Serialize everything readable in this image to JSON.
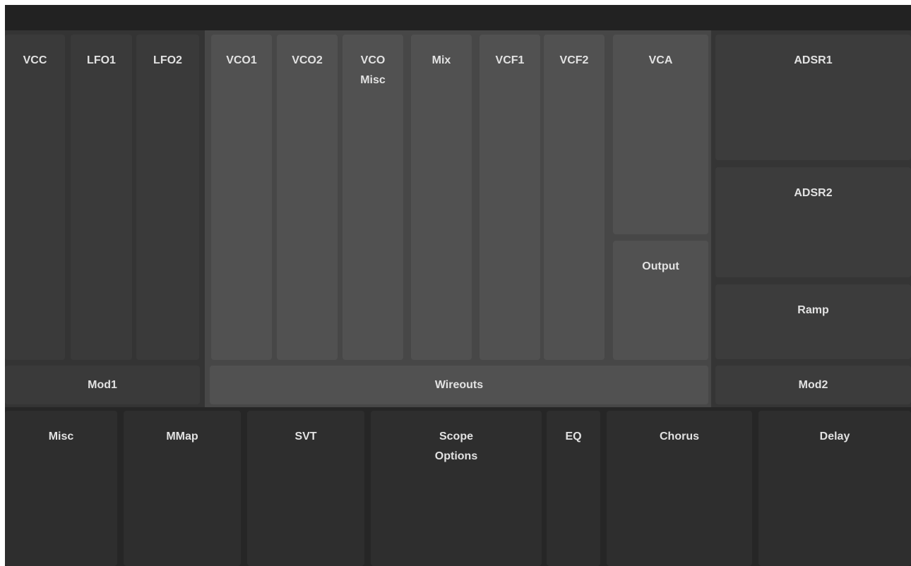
{
  "colors": {
    "window_background": "#222222",
    "left_zone": "#343434",
    "left_panel": "#3a3a3a",
    "center_zone": "#474747",
    "center_panel": "#515151",
    "right_zone": "#353535",
    "right_panel": "#3c3c3c",
    "bottom_zone": "#262626",
    "bottom_panel": "#2e2e2e",
    "label_text": "#e2e2e2"
  },
  "left_group": {
    "modules": [
      "VCC",
      "LFO1",
      "LFO2"
    ],
    "footer": "Mod1"
  },
  "center_group": {
    "modules": [
      "VCO1",
      "VCO2",
      "VCO\nMisc",
      "Mix",
      "VCF1",
      "VCF2"
    ],
    "vca": "VCA",
    "output": "Output",
    "footer": "Wireouts"
  },
  "right_group": {
    "modules": [
      "ADSR1",
      "ADSR2",
      "Ramp"
    ],
    "footer": "Mod2"
  },
  "bottom_group": {
    "modules": [
      "Misc",
      "MMap",
      "SVT",
      "Scope\nOptions",
      "EQ",
      "Chorus",
      "Delay"
    ]
  }
}
